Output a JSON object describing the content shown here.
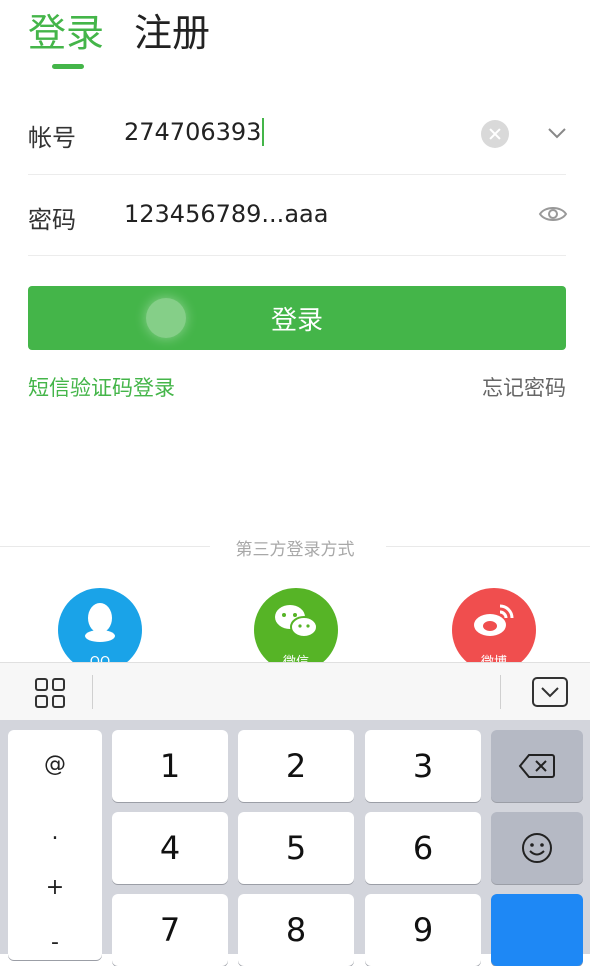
{
  "tabs": {
    "login": "登录",
    "register": "注册"
  },
  "form": {
    "account_label": "帐号",
    "account_value": "274706393",
    "password_label": "密码",
    "password_value": "123456789...aaa"
  },
  "login_button": "登录",
  "links": {
    "sms_login": "短信验证码登录",
    "forgot_password": "忘记密码"
  },
  "third_party": {
    "title": "第三方登录方式",
    "providers": [
      {
        "label": "QQ",
        "color": "#1aa3e8"
      },
      {
        "label": "微信",
        "color": "#56b426"
      },
      {
        "label": "微博",
        "color": "#f04e4e"
      }
    ]
  },
  "keyboard": {
    "symbols": [
      "@",
      ".",
      "+",
      "-"
    ],
    "keys": [
      "1",
      "2",
      "3",
      "4",
      "5",
      "6",
      "7",
      "8",
      "9"
    ],
    "icons": [
      "grid-icon",
      "keyboard-hide-icon",
      "backspace-icon",
      "emoji-icon"
    ]
  },
  "colors": {
    "accent": "#44b549",
    "key_blue": "#1e88f5"
  }
}
